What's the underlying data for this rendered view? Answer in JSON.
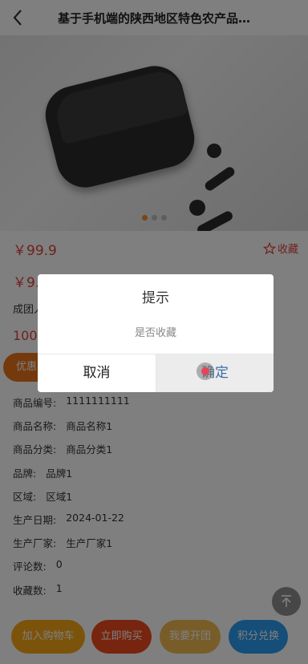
{
  "header": {
    "title": "基于手机端的陕西地区特色农产品电商平台",
    "back_icon": "chevron-left-icon"
  },
  "product": {
    "price": "￥99.9",
    "favorite_label": "收藏",
    "price_second": "￥9...",
    "desc_partial": "成团人",
    "num_partial": "100",
    "pill_partial": "优惠",
    "carousel_dots": 3,
    "carousel_active": 0
  },
  "info": [
    {
      "k": "商品编号:",
      "v": "1111111111"
    },
    {
      "k": "商品名称:",
      "v": "商品名称1"
    },
    {
      "k": "商品分类:",
      "v": "商品分类1"
    },
    {
      "k": "品牌:",
      "v": "品牌1"
    },
    {
      "k": "区域:",
      "v": "区域1"
    },
    {
      "k": "生产日期:",
      "v": "2024-01-22"
    },
    {
      "k": "生产厂家:",
      "v": "生产厂家1"
    },
    {
      "k": "评论数:",
      "v": "0"
    },
    {
      "k": "收藏数:",
      "v": "1"
    }
  ],
  "buttons": {
    "add_cart": "加入购物车",
    "buy_now": "立即购买",
    "open_group": "我要开团",
    "points": "积分兑换"
  },
  "dialog": {
    "title": "提示",
    "message": "是否收藏",
    "cancel": "取消",
    "confirm": "确定"
  },
  "colors": {
    "price": "#e0413a",
    "add_cart": "#f7a617",
    "buy_now": "#ef4a1f",
    "open_group": "#f1bb52",
    "points": "#2b9cf0",
    "confirm_text": "#3d6ea6"
  }
}
